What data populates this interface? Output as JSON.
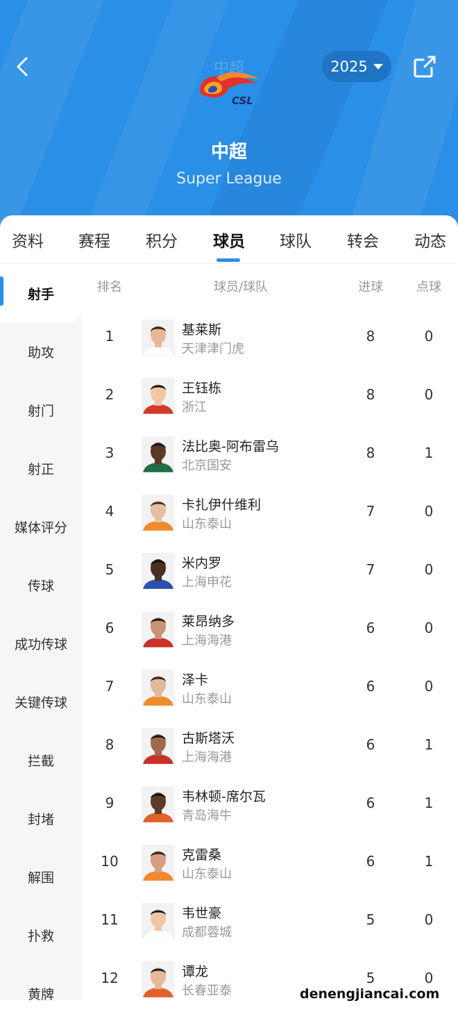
{
  "header": {
    "logo_ghost_text": "中超",
    "logo_text": "CSL",
    "season": "2025",
    "league_cn": "中超",
    "league_en": "Super League",
    "colors": {
      "header_bg": "#2a8fe6",
      "accent": "#2a8fe6",
      "pill_bg": "#1f74c4"
    }
  },
  "tabs": [
    {
      "label": "资料"
    },
    {
      "label": "赛程"
    },
    {
      "label": "积分"
    },
    {
      "label": "球员",
      "active": true
    },
    {
      "label": "球队"
    },
    {
      "label": "转会"
    },
    {
      "label": "动态"
    }
  ],
  "sidebar": {
    "items": [
      {
        "label": "射手",
        "active": true
      },
      {
        "label": "助攻"
      },
      {
        "label": "射门"
      },
      {
        "label": "射正"
      },
      {
        "label": "媒体评分"
      },
      {
        "label": "传球"
      },
      {
        "label": "成功传球"
      },
      {
        "label": "关键传球"
      },
      {
        "label": "拦截"
      },
      {
        "label": "封堵"
      },
      {
        "label": "解围"
      },
      {
        "label": "扑救"
      },
      {
        "label": "黄牌"
      }
    ]
  },
  "table": {
    "headers": {
      "rank": "排名",
      "player": "球员/球队",
      "goals": "进球",
      "penalties": "点球"
    },
    "rows": [
      {
        "rank": "1",
        "name": "基莱斯",
        "team": "天津津门虎",
        "goals": "8",
        "penalties": "0",
        "skin": "#e8b896",
        "hair": "#2b1d14",
        "kit": "#ffffff"
      },
      {
        "rank": "2",
        "name": "王钰栋",
        "team": "浙江",
        "goals": "8",
        "penalties": "0",
        "skin": "#f0c8a4",
        "hair": "#111111",
        "kit": "#d23a2a"
      },
      {
        "rank": "3",
        "name": "法比奥-阿布雷乌",
        "team": "北京国安",
        "goals": "8",
        "penalties": "1",
        "skin": "#5a3a26",
        "hair": "#1a1a1a",
        "kit": "#1f6e45"
      },
      {
        "rank": "4",
        "name": "卡扎伊什维利",
        "team": "山东泰山",
        "goals": "7",
        "penalties": "0",
        "skin": "#e6bfa0",
        "hair": "#3a2a20",
        "kit": "#f08a2a"
      },
      {
        "rank": "5",
        "name": "米内罗",
        "team": "上海申花",
        "goals": "7",
        "penalties": "0",
        "skin": "#4a2e20",
        "hair": "#111111",
        "kit": "#2a4fb0"
      },
      {
        "rank": "6",
        "name": "莱昂纳多",
        "team": "上海海港",
        "goals": "6",
        "penalties": "0",
        "skin": "#c99474",
        "hair": "#1a1410",
        "kit": "#c8312a"
      },
      {
        "rank": "7",
        "name": "泽卡",
        "team": "山东泰山",
        "goals": "6",
        "penalties": "0",
        "skin": "#e2b898",
        "hair": "#2a1e16",
        "kit": "#f08a2a"
      },
      {
        "rank": "8",
        "name": "古斯塔沃",
        "team": "上海海港",
        "goals": "6",
        "penalties": "1",
        "skin": "#a06a4a",
        "hair": "#111111",
        "kit": "#c8312a"
      },
      {
        "rank": "9",
        "name": "韦林顿-席尔瓦",
        "team": "青岛海牛",
        "goals": "6",
        "penalties": "1",
        "skin": "#5e3a28",
        "hair": "#111111",
        "kit": "#e0622a"
      },
      {
        "rank": "10",
        "name": "克雷桑",
        "team": "山东泰山",
        "goals": "6",
        "penalties": "1",
        "skin": "#d2a080",
        "hair": "#2a1c14",
        "kit": "#f08a2a"
      },
      {
        "rank": "11",
        "name": "韦世豪",
        "team": "成都蓉城",
        "goals": "5",
        "penalties": "0",
        "skin": "#eec6a2",
        "hair": "#151515",
        "kit": "#ffffff"
      },
      {
        "rank": "12",
        "name": "谭龙",
        "team": "长春亚泰",
        "goals": "5",
        "penalties": "0",
        "skin": "#e8b894",
        "hair": "#151515",
        "kit": "#e0622a"
      }
    ]
  },
  "watermark": "denengjiancai.com"
}
